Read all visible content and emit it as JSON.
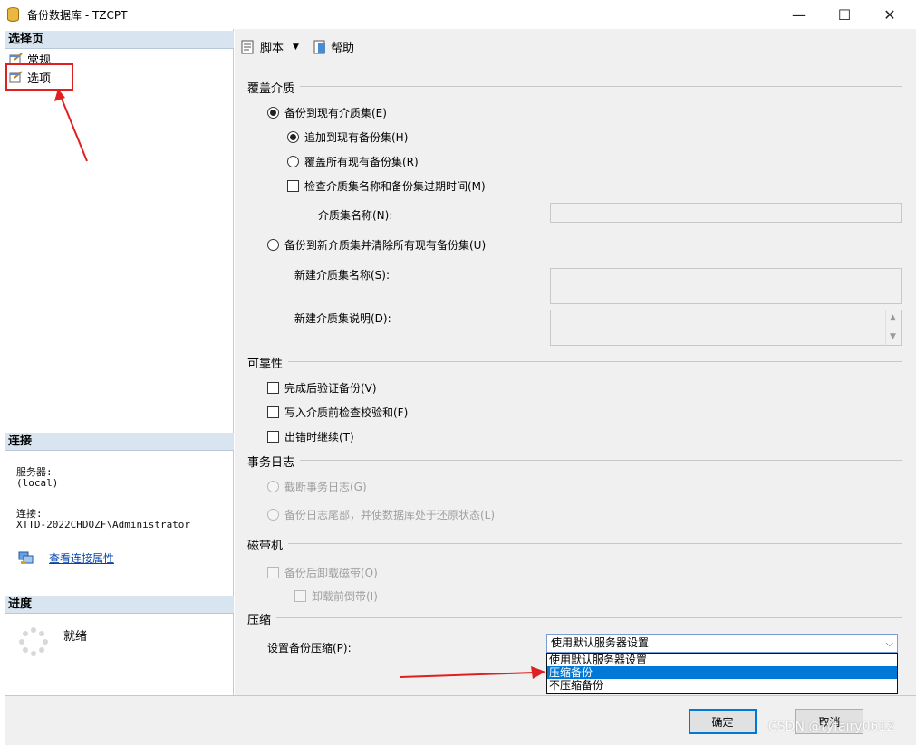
{
  "window": {
    "title": "备份数据库 - TZCPT",
    "minimize": "—",
    "maximize": "☐",
    "close": "✕"
  },
  "left": {
    "select_page_header": "选择页",
    "pages": [
      {
        "label": "常规",
        "icon": "page-settings-icon"
      },
      {
        "label": "选项",
        "icon": "page-settings-icon"
      }
    ],
    "connection_header": "连接",
    "server_label": "服务器:",
    "server_value": "(local)",
    "connection_label": "连接:",
    "connection_value": "XTTD-2022CHDOZF\\Administrator",
    "view_connection_link": "查看连接属性",
    "progress_header": "进度",
    "progress_status": "就绪"
  },
  "toolbar": {
    "script_label": "脚本",
    "help_label": "帮助"
  },
  "overwrite_media": {
    "title": "覆盖介质",
    "backup_existing": "备份到现有介质集(E)",
    "append_existing": "追加到现有备份集(H)",
    "overwrite_all": "覆盖所有现有备份集(R)",
    "check_name_expiry": "检查介质集名称和备份集过期时间(M)",
    "media_set_name": "介质集名称(N):",
    "backup_new": "备份到新介质集并清除所有现有备份集(U)",
    "new_media_set_name": "新建介质集名称(S):",
    "new_media_set_desc": "新建介质集说明(D):"
  },
  "reliability": {
    "title": "可靠性",
    "verify": "完成后验证备份(V)",
    "checksum": "写入介质前检查校验和(F)",
    "continue_on_error": "出错时继续(T)"
  },
  "transaction_log": {
    "title": "事务日志",
    "truncate": "截断事务日志(G)",
    "backup_tail": "备份日志尾部，并使数据库处于还原状态(L)"
  },
  "tape": {
    "title": "磁带机",
    "unload": "备份后卸载磁带(O)",
    "rewind": "卸载前倒带(I)"
  },
  "compression": {
    "title": "压缩",
    "label": "设置备份压缩(P):",
    "selected": "使用默认服务器设置",
    "options": [
      "使用默认服务器设置",
      "压缩备份",
      "不压缩备份"
    ],
    "highlighted_index": 1
  },
  "buttons": {
    "ok": "确定",
    "cancel": "取消"
  },
  "watermark": "CSDN @tyfairy0612",
  "colors": {
    "annotation_red": "#e02020",
    "selection_blue": "#0078d7",
    "link_blue": "#0645ad",
    "header_bg": "#d8e4f0"
  }
}
